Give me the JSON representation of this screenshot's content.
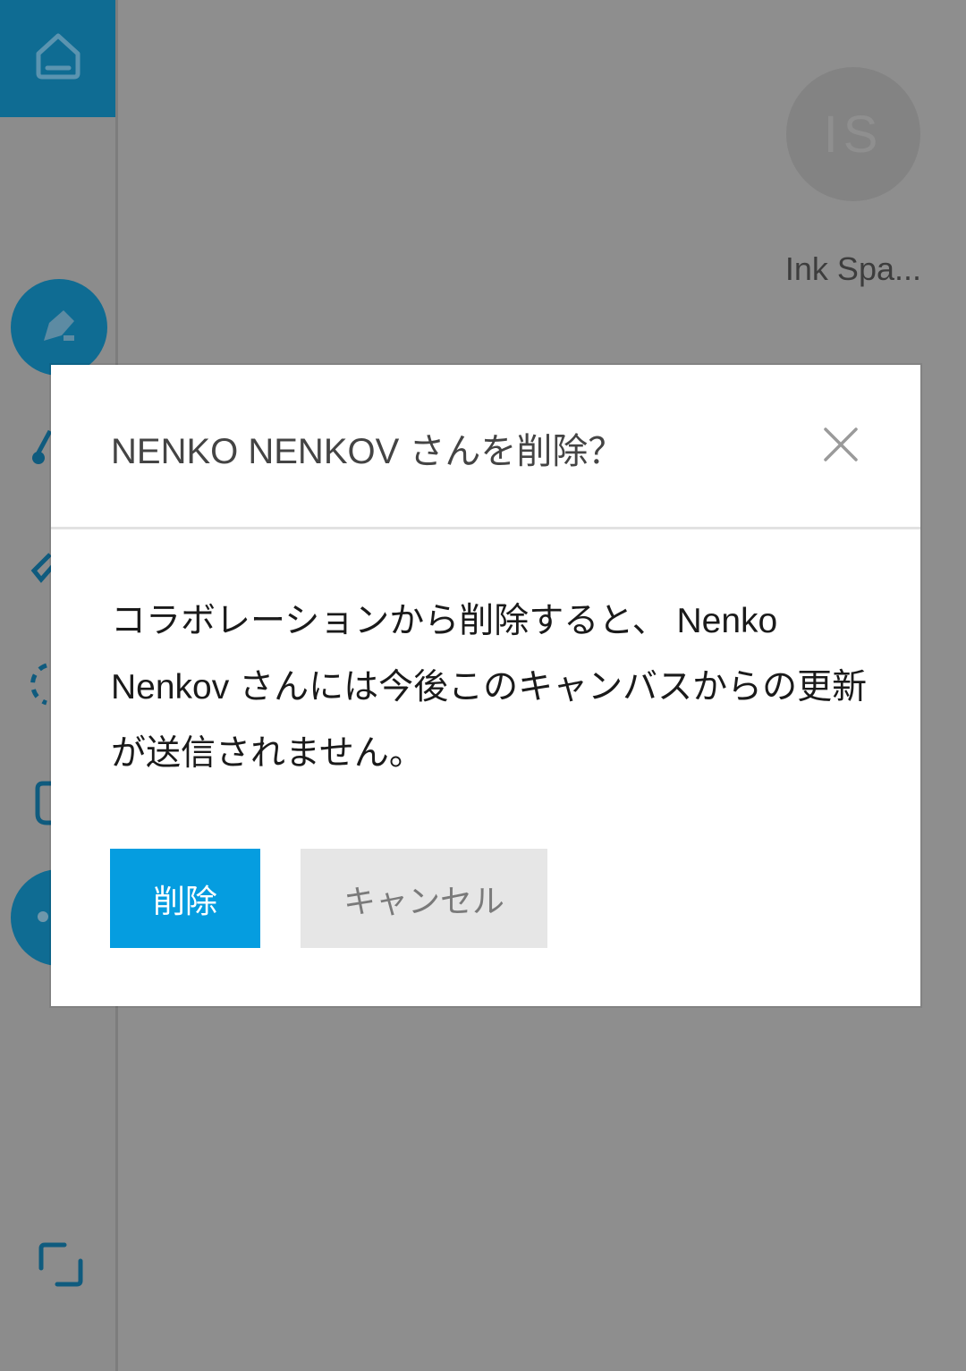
{
  "background": {
    "avatar_initials": "IS",
    "avatar_name": "Ink Spa..."
  },
  "dialog": {
    "title": "NENKO NENKOV さんを削除？",
    "message": "コラボレーションから削除すると、 Nenko Nenkov さんには今後このキャンバスからの更新が送信されません。",
    "delete_label": "削除",
    "cancel_label": "キャンセル"
  },
  "colors": {
    "accent": "#059de0",
    "sidebar_active": "#0f6c93",
    "overlay": "#8e8e8e"
  },
  "icons": [
    "home-icon",
    "pen-icon",
    "brush-icon",
    "eraser-icon",
    "lasso-icon",
    "touch-icon",
    "more-icon",
    "expand-icon",
    "close-icon"
  ]
}
